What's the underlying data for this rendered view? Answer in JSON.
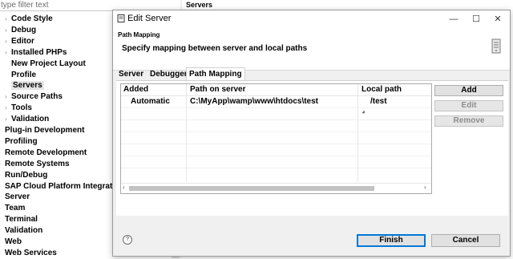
{
  "background": {
    "filter_placeholder": "type filter text",
    "right_header": "Servers",
    "tree": [
      {
        "label": "Code Style",
        "indent": 1,
        "arrow": true
      },
      {
        "label": "Debug",
        "indent": 1,
        "arrow": true
      },
      {
        "label": "Editor",
        "indent": 1,
        "arrow": true
      },
      {
        "label": "Installed PHPs",
        "indent": 1,
        "arrow": true
      },
      {
        "label": "New Project Layout",
        "indent": 1,
        "arrow": false
      },
      {
        "label": "Profile",
        "indent": 1,
        "arrow": false
      },
      {
        "label": "Servers",
        "indent": 1,
        "arrow": false,
        "selected": true
      },
      {
        "label": "Source Paths",
        "indent": 1,
        "arrow": true
      },
      {
        "label": "Tools",
        "indent": 1,
        "arrow": true
      },
      {
        "label": "Validation",
        "indent": 1,
        "arrow": true
      },
      {
        "label": "Plug-in Development",
        "indent": 0,
        "arrow": true
      },
      {
        "label": "Profiling",
        "indent": 0,
        "arrow": true
      },
      {
        "label": "Remote Development",
        "indent": 0,
        "arrow": true
      },
      {
        "label": "Remote Systems",
        "indent": 0,
        "arrow": true
      },
      {
        "label": "Run/Debug",
        "indent": 0,
        "arrow": true
      },
      {
        "label": "SAP Cloud Platform Integratio",
        "indent": 0,
        "arrow": true
      },
      {
        "label": "Server",
        "indent": 0,
        "arrow": true
      },
      {
        "label": "Team",
        "indent": 0,
        "arrow": true
      },
      {
        "label": "Terminal",
        "indent": 0,
        "arrow": true
      },
      {
        "label": "Validation",
        "indent": 0,
        "arrow": false
      },
      {
        "label": "Web",
        "indent": 0,
        "arrow": true
      },
      {
        "label": "Web Services",
        "indent": 0,
        "arrow": true
      }
    ]
  },
  "dialog": {
    "title": "Edit Server",
    "window_buttons": {
      "minimize": "—",
      "maximize": "☐",
      "close": "✕"
    },
    "header_title": "Path Mapping",
    "header_message": "Specify mapping between server and local paths",
    "header_cut_text": "n",
    "tabs": [
      {
        "label": "Server",
        "active": false
      },
      {
        "label": "Debugger",
        "active": false
      },
      {
        "label": "Path Mapping",
        "active": true
      }
    ],
    "table": {
      "columns": [
        "Added",
        "Path on server",
        "Local path"
      ],
      "rows": [
        {
          "added": "Automatic",
          "server_path": "C:\\MyApp\\wamp\\www\\htdocs\\test",
          "local_path": "/test"
        }
      ]
    },
    "side_buttons": {
      "add": "Add",
      "edit": "Edit",
      "remove": "Remove"
    },
    "bottom_buttons": {
      "finish": "Finish",
      "cancel": "Cancel"
    },
    "help_glyph": "?",
    "colors": {
      "accent": "#0078d7",
      "disabled_text": "#8c8c8c"
    }
  }
}
